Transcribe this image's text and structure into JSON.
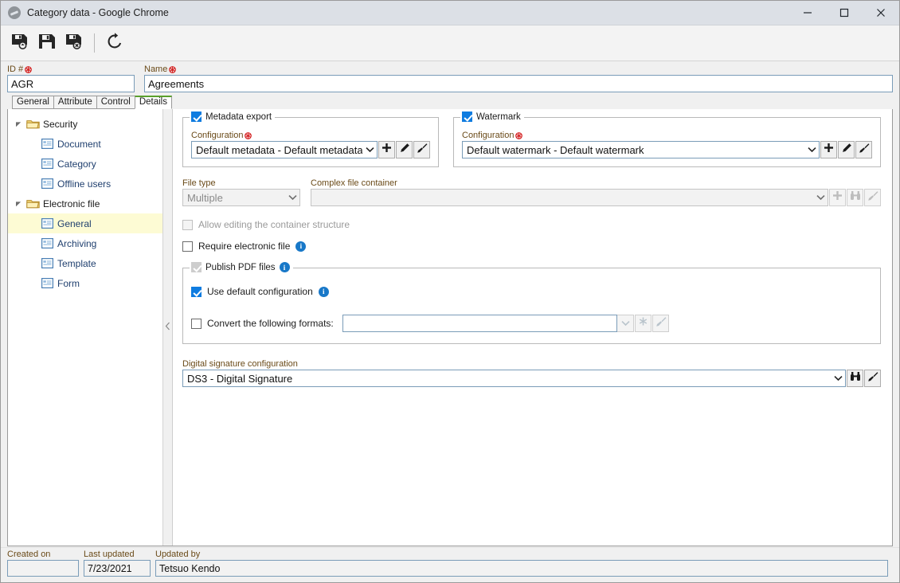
{
  "window": {
    "title": "Category data - Google Chrome",
    "app_icon": "globe-icon",
    "minimize_label": "Minimize",
    "maximize_label": "Maximize",
    "close_label": "Close"
  },
  "toolbar": {
    "buttons": [
      {
        "name": "save-and-new-button",
        "icon": "floppy-disk-plus-icon",
        "label": "Save"
      },
      {
        "name": "save-button",
        "icon": "floppy-disk-icon",
        "label": "Save and close"
      },
      {
        "name": "save-and-close-button",
        "icon": "floppy-disk-delete-icon",
        "label": "Save and exit"
      },
      {
        "name": "refresh-button",
        "icon": "refresh-icon",
        "label": "Refresh"
      }
    ]
  },
  "header": {
    "id": {
      "label": "ID #",
      "value": "AGR",
      "required": true
    },
    "name": {
      "label": "Name",
      "value": "Agreements",
      "required": true
    }
  },
  "tabs": [
    {
      "label": "General",
      "active": false
    },
    {
      "label": "Attribute",
      "active": false
    },
    {
      "label": "Control",
      "active": false
    },
    {
      "label": "Details",
      "active": true
    }
  ],
  "sidebar": {
    "items": [
      {
        "label": "Security",
        "type": "group",
        "icon": "folder-icon",
        "expanded": true,
        "selected": false
      },
      {
        "label": "Document",
        "type": "leaf",
        "icon": "form-icon",
        "selected": false
      },
      {
        "label": "Category",
        "type": "leaf",
        "icon": "form-icon",
        "selected": false
      },
      {
        "label": "Offline users",
        "type": "leaf",
        "icon": "form-icon",
        "selected": false
      },
      {
        "label": "Electronic file",
        "type": "group",
        "icon": "folder-icon",
        "expanded": true,
        "selected": false
      },
      {
        "label": "General",
        "type": "leaf",
        "icon": "form-icon",
        "selected": true
      },
      {
        "label": "Archiving",
        "type": "leaf",
        "icon": "form-icon",
        "selected": false
      },
      {
        "label": "Template",
        "type": "leaf",
        "icon": "form-icon",
        "selected": false
      },
      {
        "label": "Form",
        "type": "leaf",
        "icon": "form-icon",
        "selected": false
      }
    ],
    "collapse_icon": "chevron-left-icon"
  },
  "content": {
    "metadata_export": {
      "legend": "Metadata export",
      "checked": true,
      "config_label": "Configuration",
      "config_required": true,
      "config_value": "Default metadata - Default metadata",
      "buttons": [
        {
          "name": "metadata-add-button",
          "icon": "plus-icon",
          "disabled": false
        },
        {
          "name": "metadata-edit-button",
          "icon": "pencil-icon",
          "disabled": false
        },
        {
          "name": "metadata-clear-button",
          "icon": "broom-icon",
          "disabled": false
        }
      ]
    },
    "watermark": {
      "legend": "Watermark",
      "checked": true,
      "config_label": "Configuration",
      "config_required": true,
      "config_value": "Default watermark - Default watermark",
      "buttons": [
        {
          "name": "watermark-add-button",
          "icon": "plus-icon",
          "disabled": false
        },
        {
          "name": "watermark-edit-button",
          "icon": "pencil-icon",
          "disabled": false
        },
        {
          "name": "watermark-clear-button",
          "icon": "broom-icon",
          "disabled": false
        }
      ]
    },
    "file_type": {
      "label": "File type",
      "value": "Multiple",
      "disabled": true
    },
    "complex_file_container": {
      "label": "Complex file container",
      "value": "",
      "disabled": true,
      "buttons": [
        {
          "name": "container-add-button",
          "icon": "plus-icon",
          "disabled": true
        },
        {
          "name": "container-search-button",
          "icon": "binoculars-icon",
          "disabled": true
        },
        {
          "name": "container-clear-button",
          "icon": "broom-icon",
          "disabled": true
        }
      ]
    },
    "allow_editing_container": {
      "label": "Allow editing the container structure",
      "checked": false,
      "disabled": true
    },
    "require_electronic_file": {
      "label": "Require electronic file",
      "checked": false,
      "disabled": false,
      "info": true
    },
    "publish_pdf": {
      "legend": "Publish PDF files",
      "checked": true,
      "disabled": true,
      "info": true,
      "use_default_configuration": {
        "label": "Use default configuration",
        "checked": true,
        "info": true
      },
      "convert_formats": {
        "label": "Convert the following formats:",
        "checked": false,
        "value": "",
        "input_disabled": true,
        "buttons": [
          {
            "name": "convert-dropdown-button",
            "icon": "chevron-down-icon",
            "disabled": true
          },
          {
            "name": "convert-asterisk-button",
            "icon": "asterisk-icon",
            "disabled": true
          },
          {
            "name": "convert-clear-button",
            "icon": "broom-icon",
            "disabled": true
          }
        ]
      }
    },
    "digital_signature": {
      "label": "Digital signature configuration",
      "value": "DS3 - Digital Signature",
      "buttons": [
        {
          "name": "signature-search-button",
          "icon": "binoculars-icon",
          "disabled": false
        },
        {
          "name": "signature-clear-button",
          "icon": "broom-icon",
          "disabled": false
        }
      ]
    }
  },
  "footer": {
    "created_on": {
      "label": "Created on",
      "value": ""
    },
    "last_updated": {
      "label": "Last updated",
      "value": "7/23/2021"
    },
    "updated_by": {
      "label": "Updated by",
      "value": "Tetsuo Kendo"
    }
  },
  "colors": {
    "accent_checkbox": "#0f7ce0",
    "active_tab_underline": "#5aa02c",
    "selected_row": "#fdfbd4",
    "label_text": "#6a4a18",
    "required_marker": "#d42020",
    "info_icon": "#1878c8"
  }
}
